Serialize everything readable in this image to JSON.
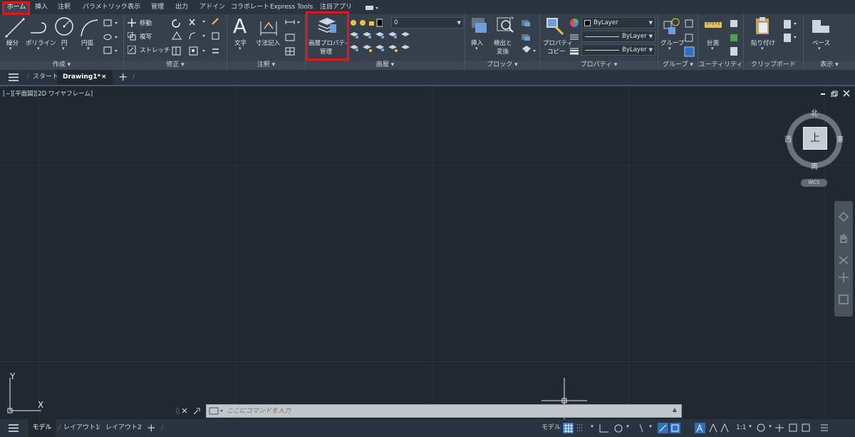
{
  "ribbon_tabs": [
    "ホーム",
    "挿入",
    "注釈",
    "パラメトリック",
    "表示",
    "管理",
    "出力",
    "アドイン",
    "コラボレート",
    "Express Tools",
    "注目アプリ"
  ],
  "panels": {
    "create": {
      "title": "作成 ▾",
      "line": "線分",
      "polyline": "ポリライン",
      "circle": "円",
      "arc": "円弧"
    },
    "modify": {
      "title": "修正 ▾",
      "move": "移動",
      "copy": "複写",
      "stretch": "ストレッチ"
    },
    "annotation": {
      "title": "注釈 ▾",
      "text": "文字",
      "dimension": "寸法記入"
    },
    "layers": {
      "title": "画層 ▾",
      "layer_props_line1": "画層プロパティ",
      "layer_props_line2": "管理",
      "current_layer": "0"
    },
    "block": {
      "title": "ブロック ▾",
      "insert": "挿入",
      "detect_line1": "検出と",
      "detect_line2": "変換"
    },
    "properties": {
      "title": "プロパティ ▾",
      "match_line1": "プロパティ",
      "match_line2": "コピー",
      "color": "ByLayer",
      "linetype": "ByLayer",
      "lineweight": "ByLayer"
    },
    "groups": {
      "title": "グループ ▾",
      "group": "グループ"
    },
    "utilities": {
      "title": "ユーティリティ ▾",
      "measure": "計測"
    },
    "clipboard": {
      "title": "クリップボード",
      "paste": "貼り付け"
    },
    "view": {
      "title": "表示 ▾",
      "base": "ベース"
    }
  },
  "doc_tabs": {
    "start": "スタート",
    "drawing": "Drawing1*",
    "close": "×",
    "add": "+"
  },
  "viewport_label": "[−][平面図][2D ワイヤフレーム]",
  "viewcube": {
    "north": "北",
    "south": "南",
    "east": "東",
    "west": "西",
    "face": "上",
    "wcs": "WCS"
  },
  "ucs": {
    "x": "X",
    "y": "Y"
  },
  "command_line": {
    "placeholder": "ここにコマンドを入力"
  },
  "layout_tabs": [
    "モデル",
    "レイアウト1",
    "レイアウト2"
  ],
  "status": {
    "model": "モデル",
    "scale": "1:1"
  },
  "colors": {
    "highlight": "#e3161e",
    "accent": "#2d6fc4",
    "ribbon": "#36404d",
    "canvas": "#212830"
  }
}
